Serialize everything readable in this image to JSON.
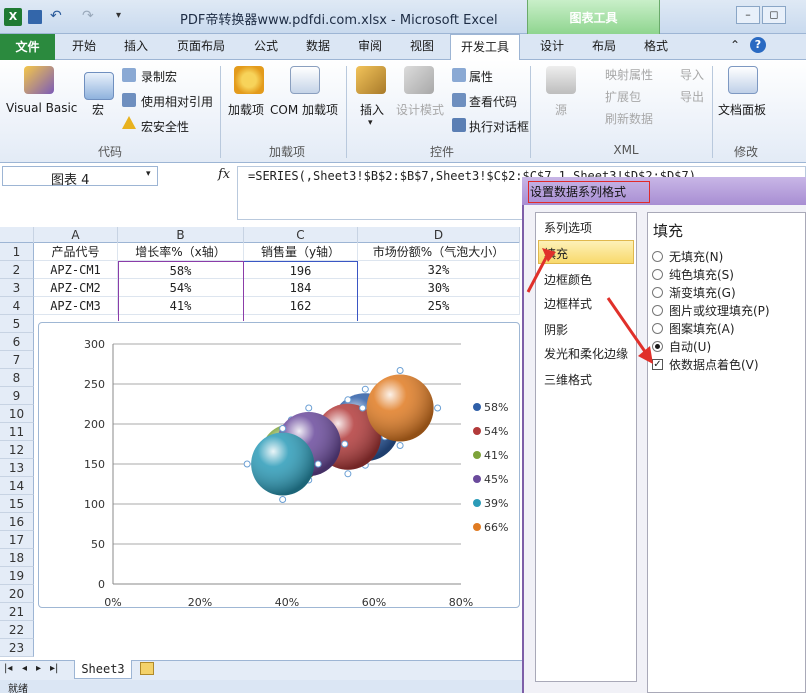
{
  "window": {
    "title": "PDF帝转换器www.pdfdi.com.xlsx - Microsoft Excel",
    "chart_tools": "图表工具",
    "restore": "◻",
    "minimize": "–"
  },
  "tabs": [
    "开始",
    "插入",
    "页面布局",
    "公式",
    "数据",
    "审阅",
    "视图",
    "开发工具",
    "设计",
    "布局",
    "格式"
  ],
  "file_tab": "文件",
  "ribbon": {
    "code": {
      "label": "代码",
      "visual_basic": "Visual Basic",
      "macro": "宏",
      "record": "录制宏",
      "relative": "使用相对引用",
      "security": "宏安全性"
    },
    "addins": {
      "label": "加载项",
      "addins": "加载项",
      "com_addins": "COM 加载项"
    },
    "controls": {
      "label": "控件",
      "insert": "插入",
      "design_mode": "设计模式",
      "properties": "属性",
      "view_code": "查看代码",
      "run_dialog": "执行对话框"
    },
    "xml": {
      "label": "XML",
      "source": "源",
      "map_props": "映射属性",
      "expansion": "扩展包",
      "refresh": "刷新数据",
      "import": "导入",
      "export": "导出"
    },
    "modify": {
      "label": "修改",
      "doc_panel": "文档面板"
    }
  },
  "namebox": "图表 4",
  "formula": "=SERIES(,Sheet3!$B$2:$B$7,Sheet3!$C$2:$C$7,1,Sheet3!$D$2:$D$7)",
  "columns": [
    "A",
    "B",
    "C",
    "D"
  ],
  "rows": [
    "1",
    "2",
    "3",
    "4",
    "5",
    "6",
    "7",
    "8",
    "9",
    "10",
    "11",
    "12",
    "13",
    "14",
    "15",
    "16",
    "17",
    "18",
    "19",
    "20",
    "21",
    "22",
    "23"
  ],
  "table": {
    "headers": [
      "产品代号",
      "增长率%（x轴）",
      "销售量（y轴）",
      "市场份额%（气泡大小）"
    ],
    "data": [
      [
        "APZ-CM1",
        "58%",
        "196",
        "32%"
      ],
      [
        "APZ-CM2",
        "54%",
        "184",
        "30%"
      ],
      [
        "APZ-CM3",
        "41%",
        "162",
        "25%"
      ]
    ]
  },
  "chart_data": {
    "type": "scatter",
    "subtype": "bubble",
    "y_ticks": [
      "300",
      "250",
      "200",
      "150",
      "100",
      "50",
      "0"
    ],
    "x_ticks": [
      "0%",
      "20%",
      "40%",
      "60%",
      "80%"
    ],
    "xlim": [
      0,
      0.8
    ],
    "ylim": [
      0,
      300
    ],
    "grid": true,
    "legend_position": "right",
    "legend": [
      "58%",
      "54%",
      "41%",
      "45%",
      "39%",
      "66%"
    ],
    "points": [
      {
        "x": 0.58,
        "y": 196,
        "size": 0.32,
        "color": "#2f5fa8"
      },
      {
        "x": 0.54,
        "y": 184,
        "size": 0.3,
        "color": "#b23a3a"
      },
      {
        "x": 0.41,
        "y": 162,
        "size": 0.25,
        "color": "#7da33a"
      },
      {
        "x": 0.45,
        "y": 175,
        "size": 0.28,
        "color": "#6a4a9c"
      },
      {
        "x": 0.39,
        "y": 150,
        "size": 0.27,
        "color": "#2b9bb8"
      },
      {
        "x": 0.66,
        "y": 220,
        "size": 0.31,
        "color": "#e07b22"
      }
    ]
  },
  "sheet_tab": "Sheet3",
  "status": "就绪",
  "dialog": {
    "title": "设置数据系列格式",
    "nav": [
      "系列选项",
      "填充",
      "边框颜色",
      "边框样式",
      "阴影",
      "发光和柔化边缘",
      "三维格式"
    ],
    "panel_title": "填充",
    "options": [
      "无填充(N)",
      "纯色填充(S)",
      "渐变填充(G)",
      "图片或纹理填充(P)",
      "图案填充(A)",
      "自动(U)"
    ],
    "checkbox": "依数据点着色(V)"
  }
}
